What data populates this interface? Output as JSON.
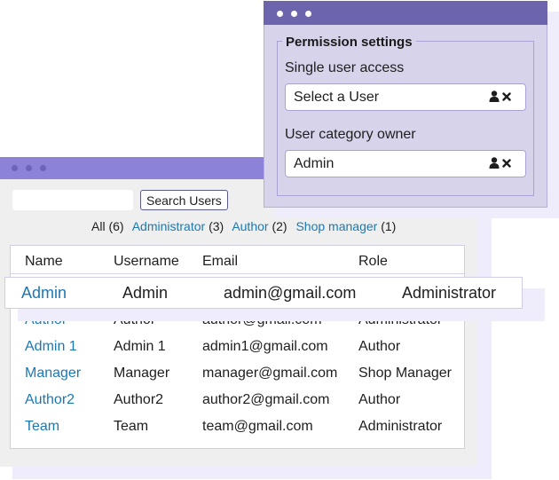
{
  "user_list_window": {
    "search": {
      "value": "",
      "placeholder": ""
    },
    "search_button_label": "Search Users",
    "filters": [
      {
        "label": "All",
        "count": "(6)",
        "link": false
      },
      {
        "label": "Administrator",
        "count": "(3)",
        "link": true
      },
      {
        "label": "Author",
        "count": "(2)",
        "link": true
      },
      {
        "label": "Shop manager",
        "count": "(1)",
        "link": true
      }
    ],
    "table": {
      "columns": [
        "Name",
        "Username",
        "Email",
        "Role"
      ],
      "highlighted_row": {
        "name": "Admin",
        "username": "Admin",
        "email": "admin@gmail.com",
        "role": "Administrator"
      },
      "rows": [
        {
          "name": "Author",
          "username": "Author",
          "email": "author@gmail.com",
          "role": "Administrator"
        },
        {
          "name": "Admin 1",
          "username": "Admin 1",
          "email": "admin1@gmail.com",
          "role": "Author"
        },
        {
          "name": "Manager",
          "username": "Manager",
          "email": "manager@gmail.com",
          "role": "Shop Manager"
        },
        {
          "name": "Author2",
          "username": "Author2",
          "email": "author2@gmail.com",
          "role": "Author"
        },
        {
          "name": "Team",
          "username": "Team",
          "email": "team@gmail.com",
          "role": "Administrator"
        }
      ]
    }
  },
  "permission_window": {
    "legend": "Permission settings",
    "single_user_access": {
      "label": "Single user access",
      "value": "Select a User"
    },
    "user_category_owner": {
      "label": "User category owner",
      "value": "Admin"
    }
  },
  "colors": {
    "back_titlebar": "#8c82d8",
    "front_titlebar": "#6c65ae",
    "link": "#1a78b4",
    "panel_bg": "#d6d3ea"
  }
}
